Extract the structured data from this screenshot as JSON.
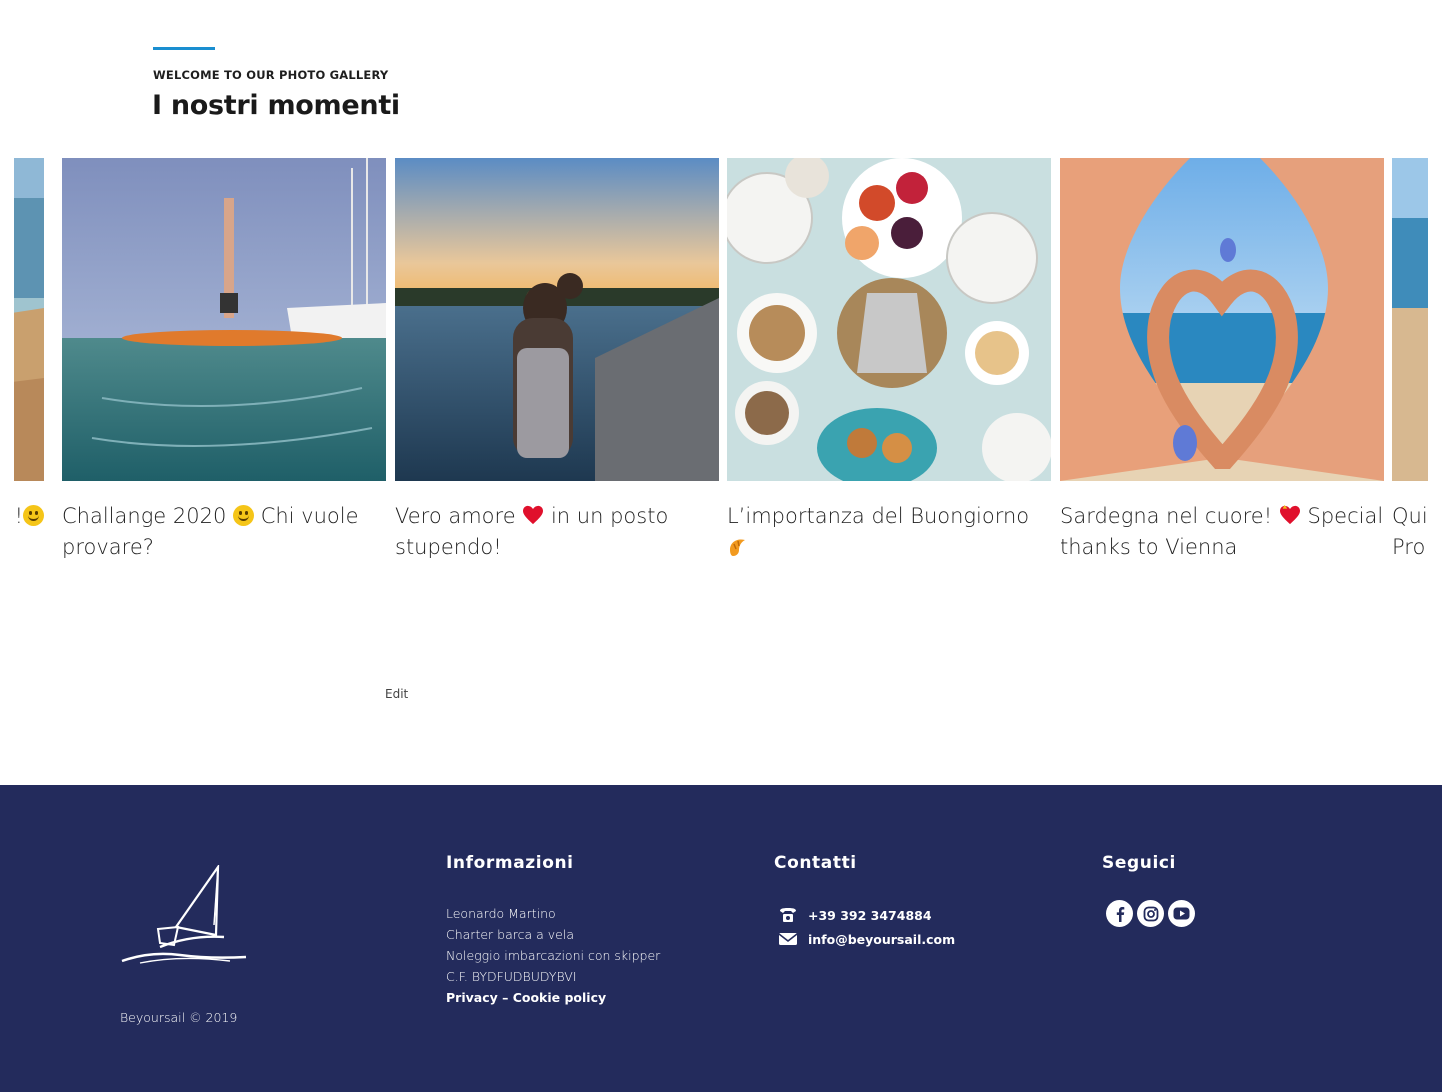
{
  "gallery": {
    "eyebrow": "WELCOME TO OUR PHOTO GALLERY",
    "title": "I nostri momenti",
    "edit_label": "Edit"
  },
  "slides": [
    {
      "caption_tail": "!"
    },
    {
      "caption_a": "Challange 2020 ",
      "caption_b": " Chi vuole provare?",
      "emoji": "slightly-smiling-face"
    },
    {
      "caption_a": "Vero amore ",
      "caption_b": " in un posto stupendo!",
      "emoji": "red-heart"
    },
    {
      "caption_a": "L’importanza del Buongiorno ",
      "emoji": "croissant"
    },
    {
      "caption_a": "Sardegna nel cuore! ",
      "caption_b": " Special thanks to Vienna",
      "emoji": "heart-with-ribbon"
    },
    {
      "caption_a": "Qui",
      "caption_b": "Pro"
    }
  ],
  "footer": {
    "copyright": "Beyoursail © 2019",
    "info": {
      "heading": "Informazioni",
      "lines": [
        "Leonardo Martino",
        "Charter barca a vela",
        "Noleggio imbarcazioni con skipper",
        "C.F. BYDFUDBUDYBVI"
      ],
      "policy": "Privacy – Cookie policy"
    },
    "contact": {
      "heading": "Contatti",
      "phone": "+39 392 3474884",
      "email": "info@beyoursail.com"
    },
    "social": {
      "heading": "Seguici",
      "icons": [
        "facebook-icon",
        "instagram-icon",
        "youtube-icon"
      ]
    }
  },
  "colors": {
    "accent": "#1a8ed0",
    "footer_bg": "#232b5c"
  }
}
